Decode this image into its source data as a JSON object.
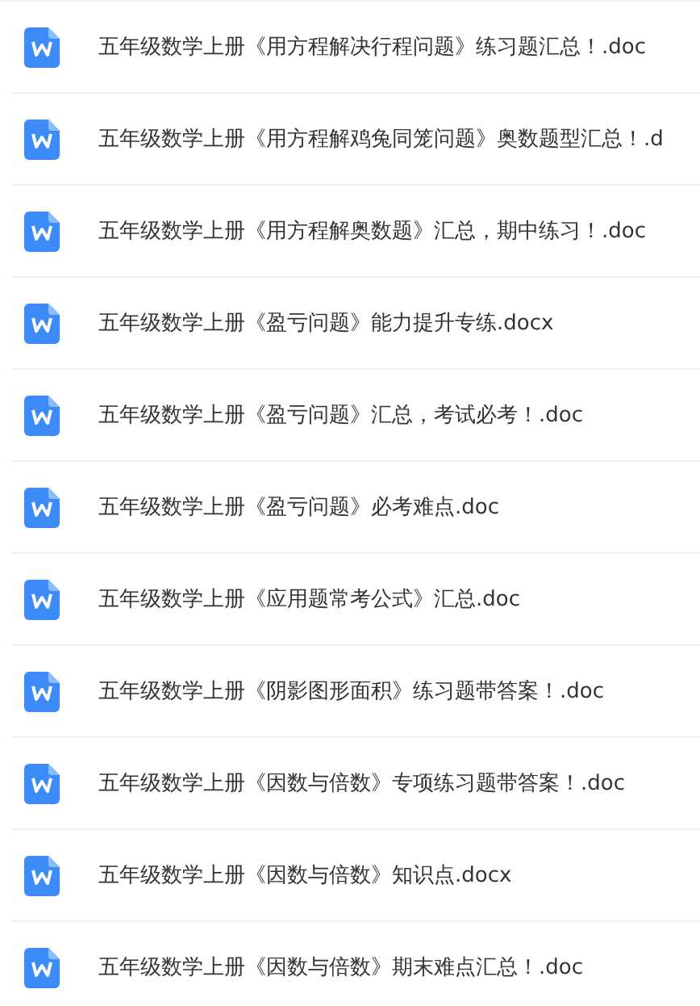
{
  "files": [
    {
      "name": "五年级数学上册《用方程解决行程问题》练习题汇总！.doc"
    },
    {
      "name": "五年级数学上册《用方程解鸡兔同笼问题》奥数题型汇总！.d"
    },
    {
      "name": "五年级数学上册《用方程解奥数题》汇总，期中练习！.doc"
    },
    {
      "name": "五年级数学上册《盈亏问题》能力提升专练.docx"
    },
    {
      "name": "五年级数学上册《盈亏问题》汇总，考试必考！.doc"
    },
    {
      "name": "五年级数学上册《盈亏问题》必考难点.doc"
    },
    {
      "name": "五年级数学上册《应用题常考公式》汇总.doc"
    },
    {
      "name": "五年级数学上册《阴影图形面积》练习题带答案！.doc"
    },
    {
      "name": "五年级数学上册《因数与倍数》专项练习题带答案！.doc"
    },
    {
      "name": "五年级数学上册《因数与倍数》知识点.docx"
    },
    {
      "name": "五年级数学上册《因数与倍数》期末难点汇总！.doc"
    }
  ]
}
